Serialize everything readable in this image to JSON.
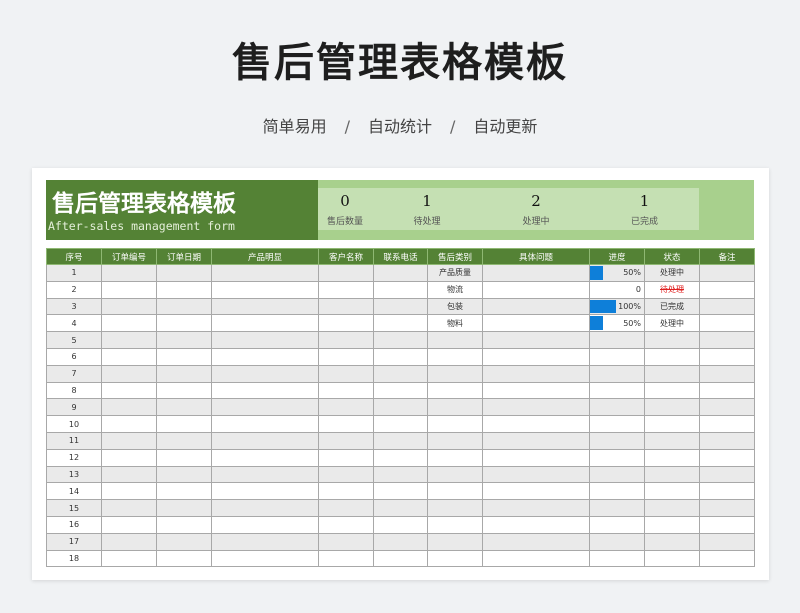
{
  "page": {
    "title": "售后管理表格模板",
    "subtitle": [
      "简单易用",
      "自动统计",
      "自动更新"
    ],
    "separator": "/"
  },
  "banner": {
    "title": "售后管理表格模板",
    "subtitle_en": "After-sales management form",
    "stats": [
      {
        "value": "0",
        "label": "售后数量"
      },
      {
        "value": "1",
        "label": "待处理"
      },
      {
        "value": "2",
        "label": "处理中"
      },
      {
        "value": "1",
        "label": "已完成"
      }
    ]
  },
  "table": {
    "columns": [
      "序号",
      "订单编号",
      "订单日期",
      "产品明显",
      "客户名称",
      "联系电话",
      "售后类别",
      "具体问题",
      "进度",
      "状态",
      "备注"
    ],
    "rows": [
      {
        "no": "1",
        "order_no": "",
        "order_date": "",
        "product": "",
        "customer": "",
        "phone": "",
        "category": "产品质量",
        "issue": "",
        "progress": 0.5,
        "progress_label": "50%",
        "status": "处理中",
        "status_type": "normal",
        "note": ""
      },
      {
        "no": "2",
        "order_no": "",
        "order_date": "",
        "product": "",
        "customer": "",
        "phone": "",
        "category": "物流",
        "issue": "",
        "progress": 0,
        "progress_label": "0",
        "status": "待处理",
        "status_type": "pending",
        "note": ""
      },
      {
        "no": "3",
        "order_no": "",
        "order_date": "",
        "product": "",
        "customer": "",
        "phone": "",
        "category": "包装",
        "issue": "",
        "progress": 1.0,
        "progress_label": "100%",
        "status": "已完成",
        "status_type": "normal",
        "note": ""
      },
      {
        "no": "4",
        "order_no": "",
        "order_date": "",
        "product": "",
        "customer": "",
        "phone": "",
        "category": "物料",
        "issue": "",
        "progress": 0.5,
        "progress_label": "50%",
        "status": "处理中",
        "status_type": "normal",
        "note": ""
      },
      {
        "no": "5"
      },
      {
        "no": "6"
      },
      {
        "no": "7"
      },
      {
        "no": "8"
      },
      {
        "no": "9"
      },
      {
        "no": "10"
      },
      {
        "no": "11"
      },
      {
        "no": "12"
      },
      {
        "no": "13"
      },
      {
        "no": "14"
      },
      {
        "no": "15"
      },
      {
        "no": "16"
      },
      {
        "no": "17"
      },
      {
        "no": "18"
      }
    ]
  },
  "colors": {
    "header_dark_green": "#548235",
    "banner_light_green": "#a8d08d",
    "stats_green": "#c5e0b3",
    "progress_blue": "#0e7fd9",
    "pending_red": "#e02020"
  }
}
